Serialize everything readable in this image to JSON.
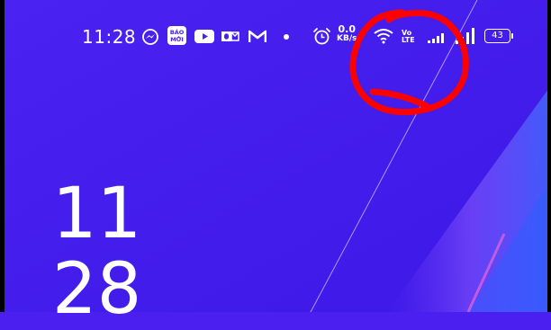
{
  "status_bar": {
    "time": "11:28",
    "notification_icons": [
      "messenger-icon",
      "sao-moi-app-icon",
      "youtube-icon",
      "outlook-icon",
      "gmail-icon",
      "more-dot-icon"
    ],
    "alarm_icon": "alarm-clock-icon",
    "net_speed_value": "0.0",
    "net_speed_unit": "KB/s",
    "wifi_icon": "wifi-icon",
    "volte_label": "Vo\nLTE",
    "signal_icons": [
      "signal-bars-sim1-icon",
      "signal-bars-sim2-icon"
    ],
    "battery_level": "43"
  },
  "app_icon_text": {
    "sao_moi": "BÁO MỚI"
  },
  "lock_screen": {
    "hour": "11",
    "minute": "28"
  },
  "colors": {
    "background": "#4a1ff0",
    "annotation": "#ff0000"
  }
}
